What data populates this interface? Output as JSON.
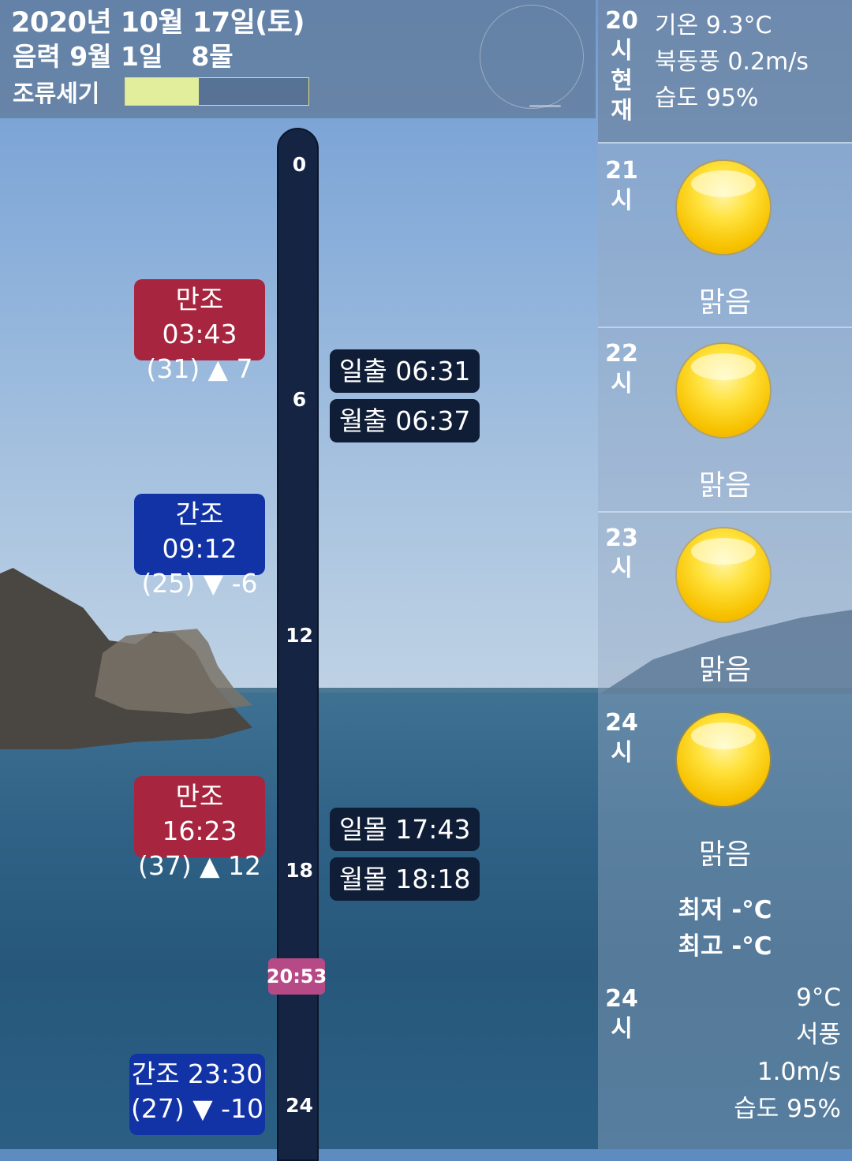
{
  "header": {
    "date": "2020년 10월 17일(토)",
    "lunar": "음력 9월 1일",
    "mul": "8물",
    "tide_strength_label": "조류세기",
    "tide_strength_level": 0.4
  },
  "timeline": {
    "hours": [
      "0",
      "6",
      "12",
      "18",
      "24"
    ],
    "now": "20:53"
  },
  "tides": [
    {
      "line1": "만조 03:43",
      "line2": "(31) ▲ 7",
      "kind": "high"
    },
    {
      "line1": "간조 09:12",
      "line2": "(25) ▼ -6",
      "kind": "low"
    },
    {
      "line1": "만조 16:23",
      "line2": "(37) ▲ 12",
      "kind": "high"
    },
    {
      "line1": "간조 23:30",
      "line2": "(27) ▼ -10",
      "kind": "low"
    }
  ],
  "sun_moon": {
    "sunrise": "일출 06:31",
    "moonrise": "월출 06:37",
    "sunset": "일몰 17:43",
    "moonset": "월몰 18:18"
  },
  "weather": {
    "current": {
      "hour": "20",
      "unit": "시",
      "label1": "현",
      "label2": "재",
      "temp": "기온 9.3°C",
      "wind": "북동풍 0.2m/s",
      "humidity": "습도 95%"
    },
    "hourly": [
      {
        "hour": "21",
        "unit": "시",
        "condition": "맑음",
        "icon": "sun-icon"
      },
      {
        "hour": "22",
        "unit": "시",
        "condition": "맑음",
        "icon": "sun-icon"
      },
      {
        "hour": "23",
        "unit": "시",
        "condition": "맑음",
        "icon": "sun-icon"
      },
      {
        "hour": "24",
        "unit": "시",
        "condition": "맑음",
        "icon": "sun-icon"
      }
    ],
    "min_temp": "최저 -°C",
    "max_temp": "최고 -°C",
    "tomorrow": {
      "hour": "24",
      "unit": "시",
      "temp": "9°C",
      "wind_dir": "서풍",
      "wind_speed": "1.0m/s",
      "humidity": "습도 95%"
    }
  },
  "colors": {
    "high_tide": "#a8253f",
    "low_tide": "#1133a6",
    "timeline": "#142442",
    "now_marker": "#b54a86",
    "tide_bar_fill": "#e3ee9c"
  }
}
